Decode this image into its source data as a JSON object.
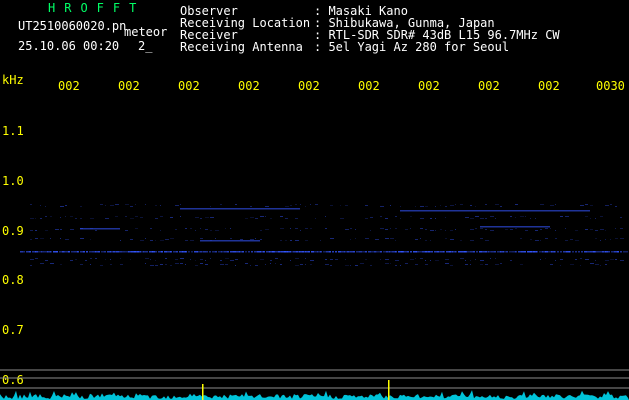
{
  "logo": {
    "text": "HROFFT"
  },
  "file": {
    "name": "UT2510060020.pn",
    "label": "meteor"
  },
  "stamp": {
    "datetime": "25.10.06 00:20",
    "count": "2_"
  },
  "info": [
    {
      "key": "Observer",
      "value": ": Masaki Kano"
    },
    {
      "key": "Receiving Location",
      "value": ": Shibukawa, Gunma, Japan"
    },
    {
      "key": "Receiver",
      "value": ": RTL-SDR SDR# 43dB L15 96.7MHz CW"
    },
    {
      "key": "Receiving Antenna",
      "value": ": 5el Yagi Az 280 for Seoul"
    }
  ],
  "axis": {
    "unit": "kHz",
    "time_ticks": [
      "002",
      "002",
      "002",
      "002",
      "002",
      "002",
      "002",
      "002",
      "002",
      "0030"
    ],
    "freq_ticks": [
      "1.1",
      "1.0",
      "0.9",
      "0.8",
      "0.7",
      "0.6"
    ]
  },
  "colors": {
    "text": "#ffff00",
    "label": "#ffffff",
    "logo": "#00ff66",
    "signal": "#3355ff",
    "spectrum": "#00e5ff",
    "gridline": "#8c8c8c",
    "marker": "#ffff00"
  }
}
